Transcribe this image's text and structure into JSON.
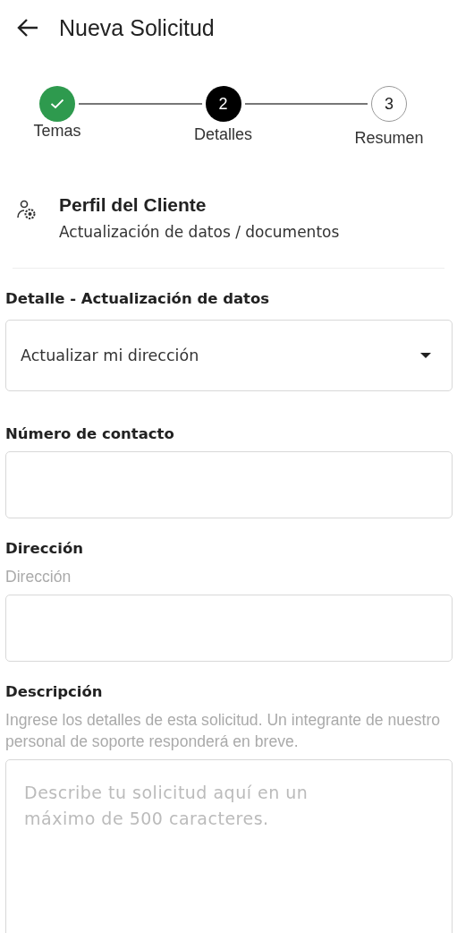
{
  "header": {
    "title": "Nueva Solicitud"
  },
  "steps": [
    {
      "label": "Temas",
      "completed": true,
      "selected": false
    },
    {
      "number": "2",
      "label": "Detalles",
      "completed": false,
      "selected": true
    },
    {
      "number": "3",
      "label": "Resumen",
      "completed": false,
      "selected": false
    }
  ],
  "category": {
    "title": "Perfil del Cliente",
    "subtitle": "Actualización de datos / documentos"
  },
  "fields": [
    {
      "kind": "select",
      "label": "Detalle - Actualización de datos",
      "value": "Actualizar mi dirección"
    },
    {
      "kind": "text",
      "label": "Número de contacto"
    },
    {
      "kind": "text",
      "label": "Dirección",
      "hint": "Dirección"
    },
    {
      "kind": "textarea",
      "label": "Descripción",
      "hint": "Ingrese los detalles de esta solicitud. Un integrante de nuestro personal de soporte responderá en breve.",
      "placeholder": "Describe tu solicitud aquí en un máximo de 500 caracteres."
    }
  ]
}
